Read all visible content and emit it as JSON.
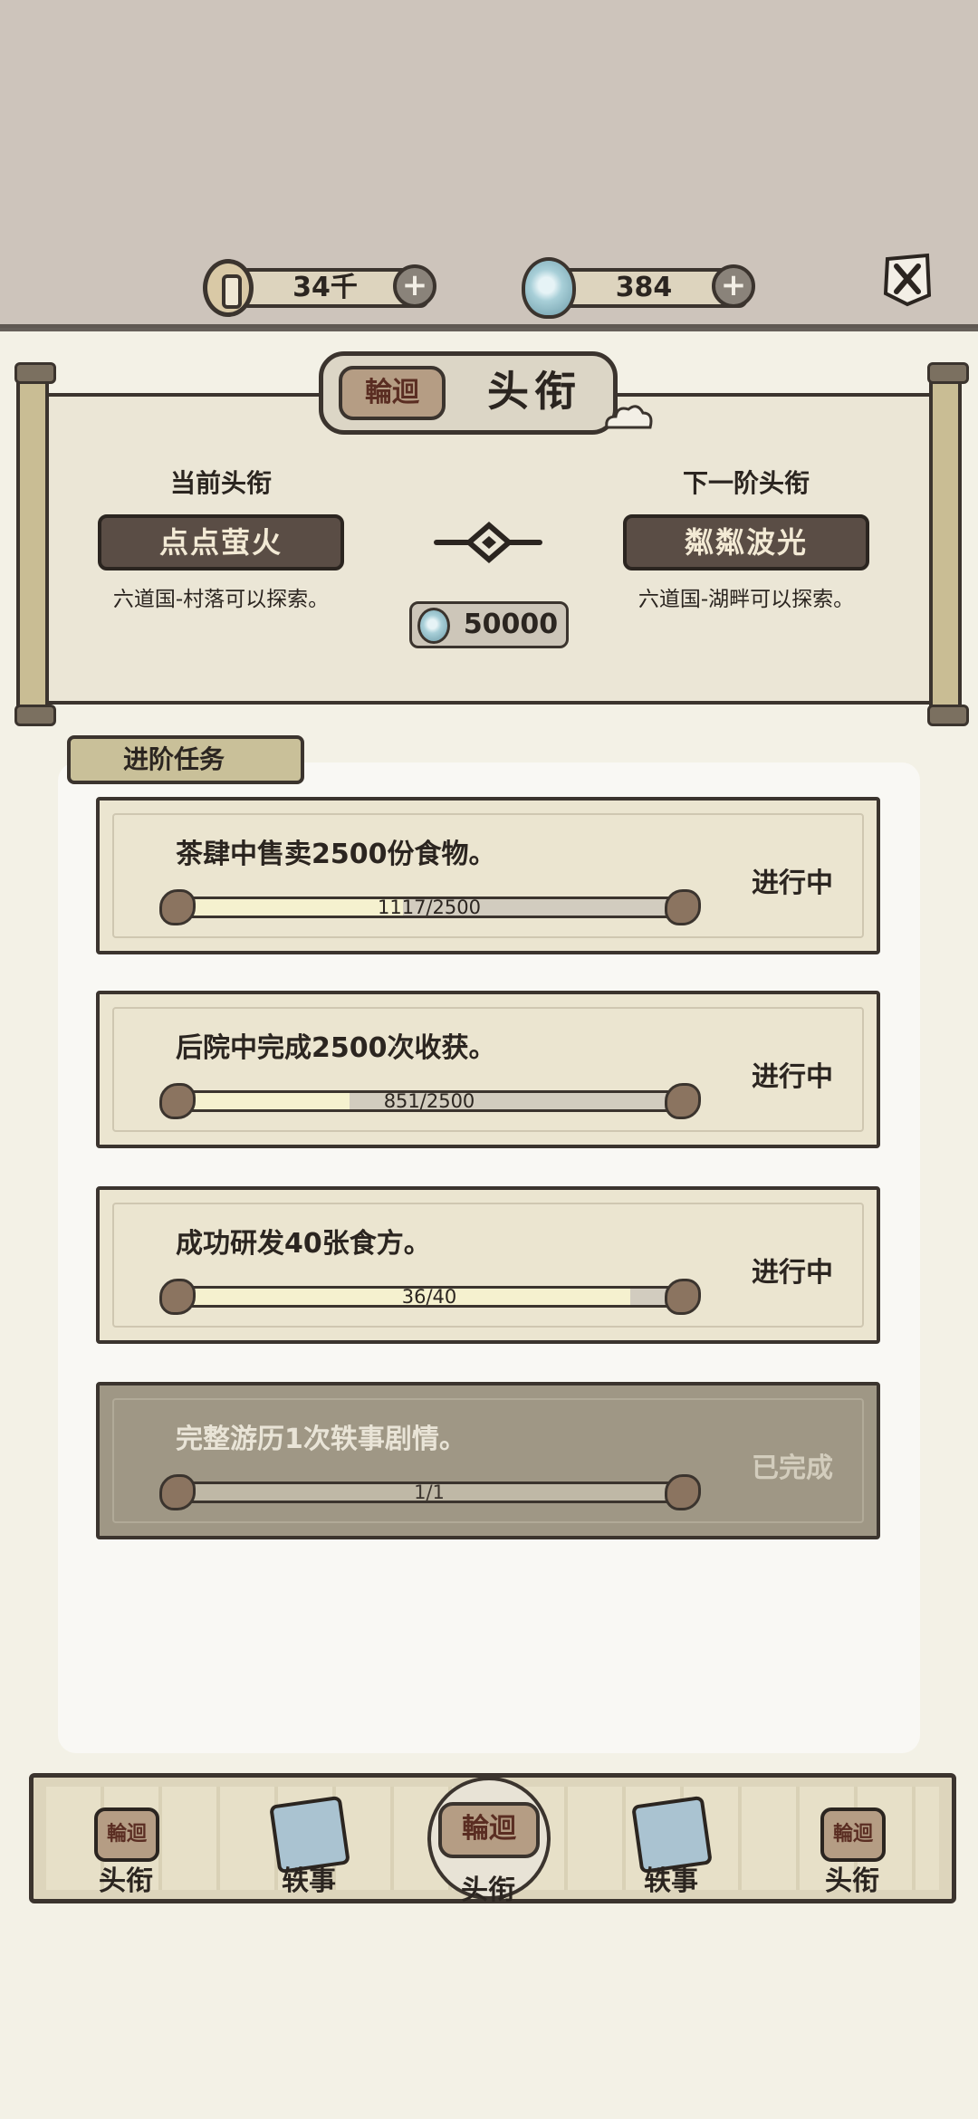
{
  "resources": {
    "coins": "34千",
    "gems": "384",
    "plus": "+"
  },
  "header": {
    "title": "头衔",
    "seal_text": "輪迴"
  },
  "rank": {
    "current_label": "当前头衔",
    "current_name": "点点萤火",
    "current_desc": "六道国-村落可以探索。",
    "next_label": "下一阶头衔",
    "next_name": "粼粼波光",
    "next_desc": "六道国-湖畔可以探索。",
    "upgrade_cost": "50000"
  },
  "tasks_section": {
    "label": "进阶任务",
    "items": [
      {
        "title": "茶肆中售卖2500份食物。",
        "progress_text": "1117/2500",
        "progress": 0.4468,
        "status": "进行中"
      },
      {
        "title": "后院中完成2500次收获。",
        "progress_text": "851/2500",
        "progress": 0.3404,
        "status": "进行中"
      },
      {
        "title": "成功研发40张食方。",
        "progress_text": "36/40",
        "progress": 0.9,
        "status": "进行中"
      },
      {
        "title": "完整游历1次轶事剧情。",
        "progress_text": "1/1",
        "progress": 1.0,
        "status": "已完成"
      }
    ]
  },
  "bottom_nav": {
    "items": [
      {
        "label": "头衔",
        "icon": "seal-icon"
      },
      {
        "label": "轶事",
        "icon": "scroll-icon"
      },
      {
        "label": "头衔",
        "icon": "seal-icon"
      },
      {
        "label": "轶事",
        "icon": "scroll-icon"
      },
      {
        "label": "头衔",
        "icon": "seal-icon"
      }
    ]
  },
  "colors": {
    "background": "#f3f1e6",
    "top_background": "#cdc4bb",
    "ink": "#2b2520",
    "button_dark": "#5a4d45",
    "completed_card": "#9f9785"
  }
}
